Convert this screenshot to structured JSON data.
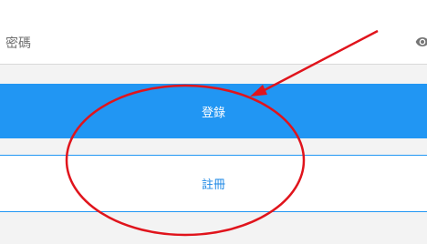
{
  "password_field": {
    "label": "密碼",
    "visibility_icon": "eye-icon"
  },
  "buttons": {
    "login_label": "登錄",
    "register_label": "註冊"
  },
  "colors": {
    "primary": "#2196f3",
    "annotation": "#e0141c",
    "background": "#f3f3f3"
  }
}
